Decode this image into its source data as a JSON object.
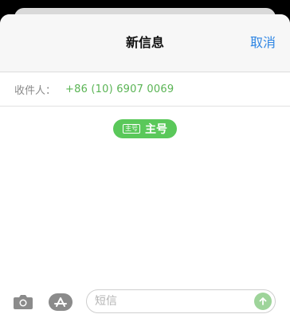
{
  "header": {
    "title": "新信息",
    "cancel_label": "取消"
  },
  "recipient": {
    "label": "收件人：",
    "value": "+86 (10) 6907 0069"
  },
  "sim_selector": {
    "badge": "主号",
    "label": "主号"
  },
  "compose": {
    "placeholder": "短信"
  },
  "icons": {
    "camera": "camera-icon",
    "app_store": "app-store-icon",
    "send": "send-arrow-icon"
  },
  "colors": {
    "accent_blue": "#2f86e4",
    "accent_green": "#5ac85a"
  }
}
